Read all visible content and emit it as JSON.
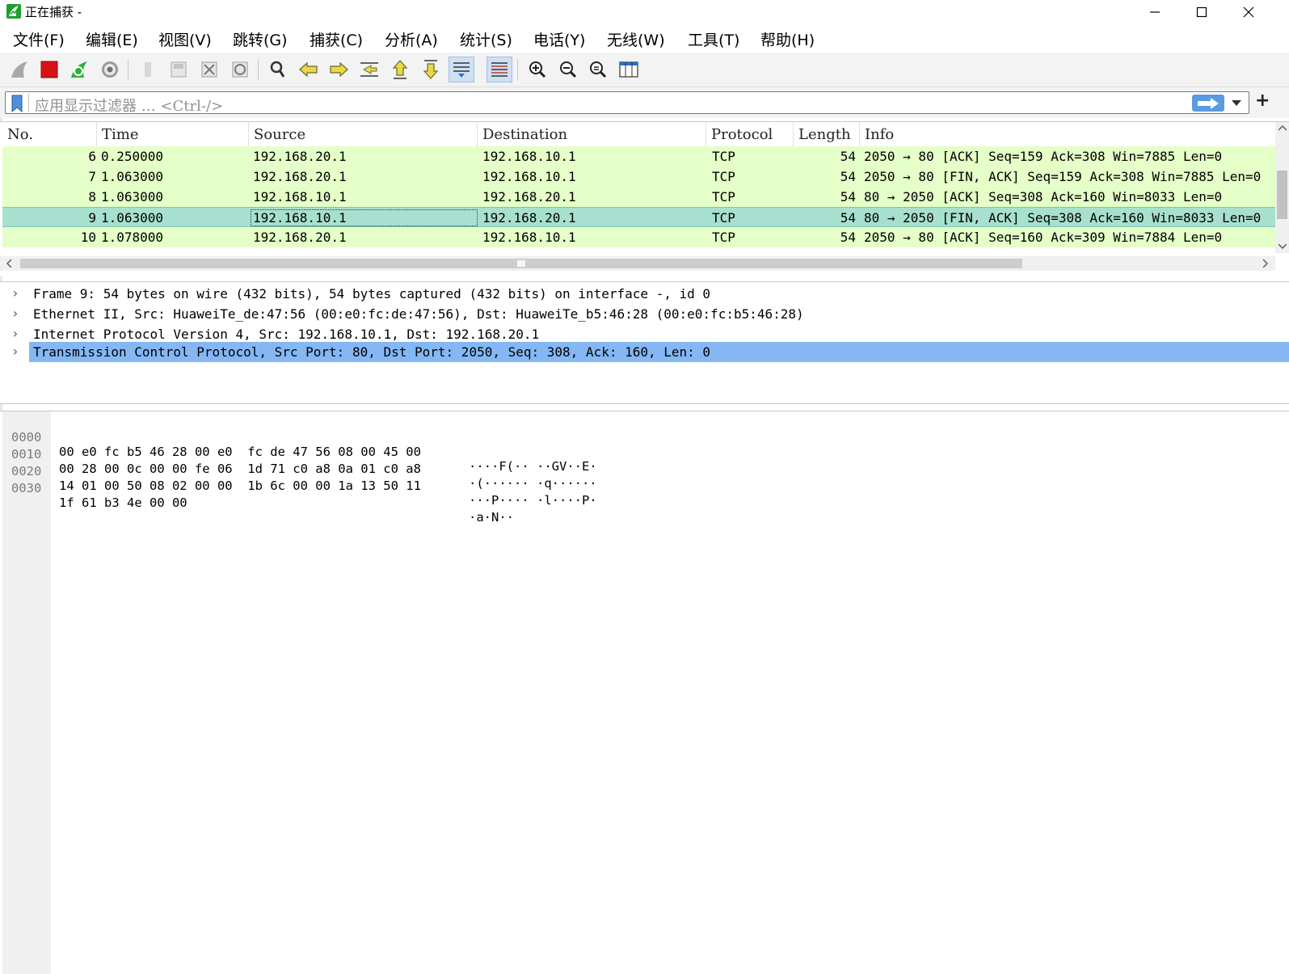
{
  "window": {
    "title": "正在捕获 -",
    "icon": "wireshark-fin-icon",
    "controls": {
      "minimize": "minimize-icon",
      "maximize": "maximize-icon",
      "close": "close-icon"
    }
  },
  "menu": [
    "文件(F)",
    "编辑(E)",
    "视图(V)",
    "跳转(G)",
    "捕获(C)",
    "分析(A)",
    "统计(S)",
    "电话(Y)",
    "无线(W)",
    "工具(T)",
    "帮助(H)"
  ],
  "toolbar": {
    "icons": [
      "start-capture-fin-icon",
      "stop-capture-icon",
      "restart-capture-icon",
      "capture-options-gear-icon",
      "open-file-icon",
      "save-file-icon",
      "close-file-icon",
      "reload-file-icon",
      "find-packet-icon",
      "go-back-icon",
      "go-forward-icon",
      "go-to-packet-icon",
      "go-first-packet-icon",
      "go-last-packet-icon",
      "auto-scroll-icon",
      "colorize-icon",
      "zoom-in-icon",
      "zoom-out-icon",
      "zoom-normal-icon",
      "resize-columns-icon"
    ]
  },
  "filter": {
    "placeholder": "应用显示过滤器 … <Ctrl-/>",
    "add_label": "+"
  },
  "packet_list": {
    "columns": [
      "No.",
      "Time",
      "Source",
      "Destination",
      "Protocol",
      "Length",
      "Info"
    ],
    "rows": [
      {
        "no": "6",
        "time": "0.250000",
        "source": "192.168.20.1",
        "destination": "192.168.10.1",
        "protocol": "TCP",
        "length": "54",
        "info": "2050 → 80 [ACK] Seq=159 Ack=308 Win=7885 Len=0"
      },
      {
        "no": "7",
        "time": "1.063000",
        "source": "192.168.20.1",
        "destination": "192.168.10.1",
        "protocol": "TCP",
        "length": "54",
        "info": "2050 → 80 [FIN, ACK] Seq=159 Ack=308 Win=7885 Len=0"
      },
      {
        "no": "8",
        "time": "1.063000",
        "source": "192.168.10.1",
        "destination": "192.168.20.1",
        "protocol": "TCP",
        "length": "54",
        "info": "80 → 2050 [ACK] Seq=308 Ack=160 Win=8033 Len=0"
      },
      {
        "no": "9",
        "time": "1.063000",
        "source": "192.168.10.1",
        "destination": "192.168.20.1",
        "protocol": "TCP",
        "length": "54",
        "info": "80 → 2050 [FIN, ACK] Seq=308 Ack=160 Win=8033 Len=0"
      },
      {
        "no": "10",
        "time": "1.078000",
        "source": "192.168.20.1",
        "destination": "192.168.10.1",
        "protocol": "TCP",
        "length": "54",
        "info": "2050 → 80 [ACK] Seq=160 Ack=309 Win=7884 Len=0"
      }
    ],
    "selected_no": "9",
    "row_color": "#e4ffc7",
    "selected_color": "#a8e0cf"
  },
  "details": [
    "Frame 9: 54 bytes on wire (432 bits), 54 bytes captured (432 bits) on interface -, id 0",
    "Ethernet II, Src: HuaweiTe_de:47:56 (00:e0:fc:de:47:56), Dst: HuaweiTe_b5:46:28 (00:e0:fc:b5:46:28)",
    "Internet Protocol Version 4, Src: 192.168.10.1, Dst: 192.168.20.1",
    "Transmission Control Protocol, Src Port: 80, Dst Port: 2050, Seq: 308, Ack: 160, Len: 0"
  ],
  "details_selected_index": 3,
  "details_selected_color": "#84b7f4",
  "bytes": [
    {
      "offset": "0000",
      "hex": "00 e0 fc b5 46 28 00 e0  fc de 47 56 08 00 45 00",
      "ascii": "····F(·· ··GV··E·"
    },
    {
      "offset": "0010",
      "hex": "00 28 00 0c 00 00 fe 06  1d 71 c0 a8 0a 01 c0 a8",
      "ascii": "·(······ ·q······"
    },
    {
      "offset": "0020",
      "hex": "14 01 00 50 08 02 00 00  1b 6c 00 00 1a 13 50 11",
      "ascii": "···P···· ·l····P·"
    },
    {
      "offset": "0030",
      "hex": "1f 61 b3 4e 00 00",
      "ascii": "·a·N··"
    }
  ]
}
